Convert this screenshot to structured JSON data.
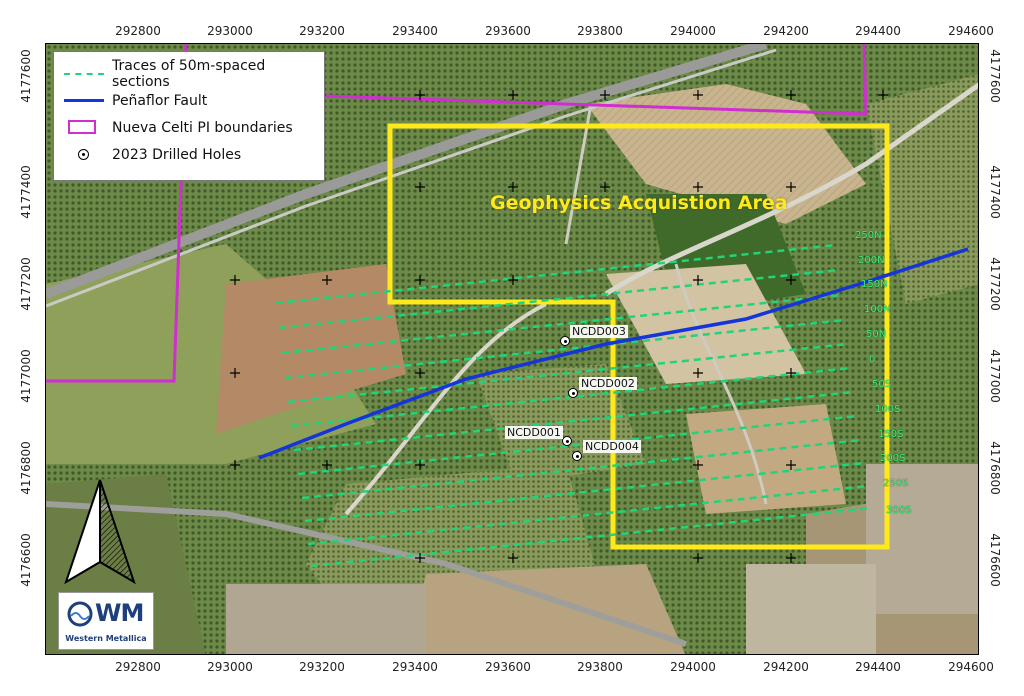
{
  "map": {
    "title": "Geophysics Acquistion Area",
    "x_ticks": [
      "292800",
      "293000",
      "293200",
      "293400",
      "293600",
      "293800",
      "294000",
      "294200",
      "294400",
      "294600"
    ],
    "y_ticks_left": [
      "4177600",
      "4177400",
      "4177200",
      "4177000",
      "4176800",
      "4176600"
    ],
    "y_ticks_right": [
      "4177600",
      "4177400",
      "4177200",
      "4177000",
      "4176800",
      "4176600"
    ]
  },
  "legend": {
    "items": [
      {
        "label": "Traces of 50m-spaced sections",
        "symbol": "green-dashed-line",
        "color": "#22d37a"
      },
      {
        "label": "Peñaflor Fault",
        "symbol": "blue-line",
        "color": "#1535d8"
      },
      {
        "label": "Nueva Celti PI boundaries",
        "symbol": "magenta-box",
        "color": "#cf2fd0"
      },
      {
        "label": "2023 Drilled Holes",
        "symbol": "dot-marker",
        "color": "#000000"
      }
    ]
  },
  "holes": [
    {
      "label": "NCDD003"
    },
    {
      "label": "NCDD002"
    },
    {
      "label": "NCDD001"
    },
    {
      "label": "NCDD004"
    }
  ],
  "sections": [
    "250N",
    "200N",
    "150N",
    "100N",
    "50N",
    "0",
    "50S",
    "100S",
    "150S",
    "200S",
    "250S",
    "300S"
  ],
  "logo": {
    "mark": "WM",
    "name": "Western Metallica"
  },
  "colors": {
    "acquisition_area": "#ffe91a",
    "fault": "#1535d8",
    "sections": "#22d37a",
    "boundary": "#cf2fd0"
  }
}
